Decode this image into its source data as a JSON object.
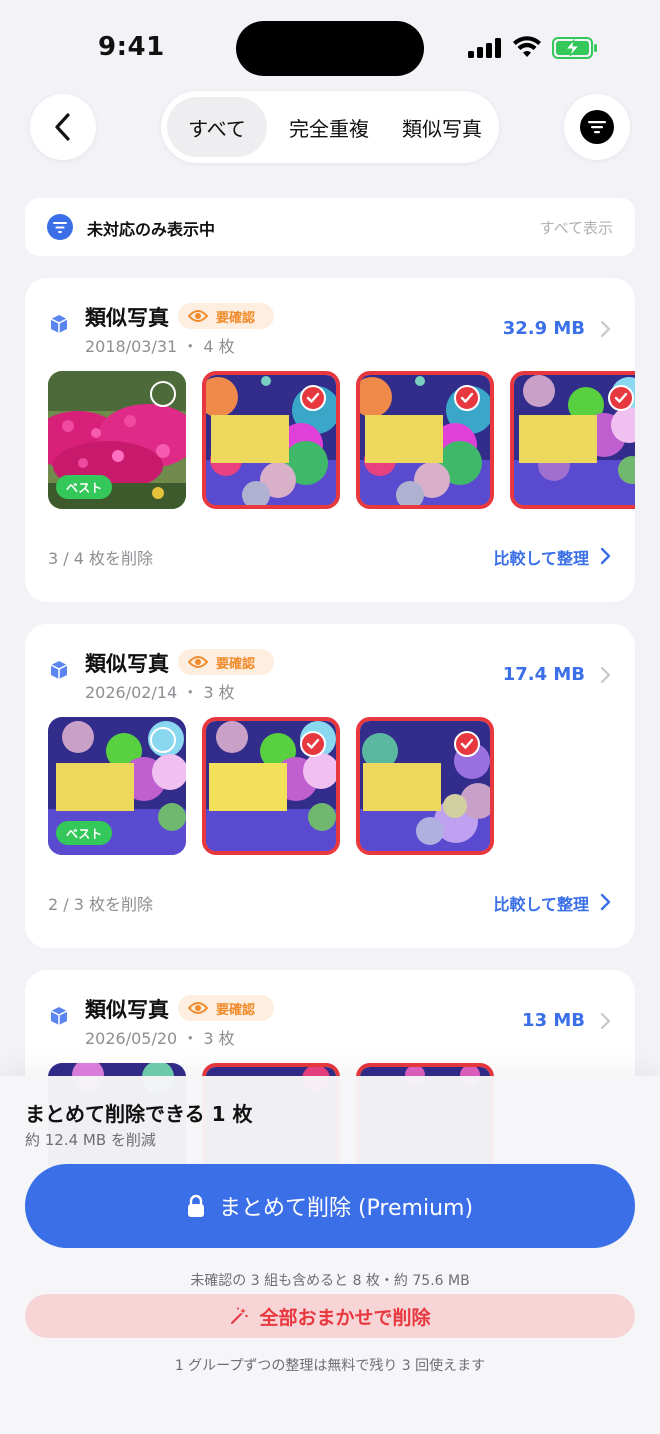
{
  "status": {
    "time": "9:41"
  },
  "nav": {
    "tabs": [
      {
        "label": "すべて",
        "active": true
      },
      {
        "label": "完全重複",
        "active": false
      },
      {
        "label": "類似写真",
        "active": false
      }
    ]
  },
  "banner": {
    "text": "未対応のみ表示中",
    "link": "すべて表示"
  },
  "groups": [
    {
      "title": "類似写真",
      "badge": "要確認",
      "date": "2018/03/31 ・ 4 枚",
      "size": "32.9 MB",
      "summary": "3 / 4 枚を削除",
      "action": "比較して整理",
      "best_label": "ベスト"
    },
    {
      "title": "類似写真",
      "badge": "要確認",
      "date": "2026/02/14 ・ 3 枚",
      "size": "17.4 MB",
      "summary": "2 / 3 枚を削除",
      "action": "比較して整理",
      "best_label": "ベスト"
    },
    {
      "title": "類似写真",
      "badge": "要確認",
      "date": "2026/05/20 ・ 3 枚",
      "size": "13 MB"
    }
  ],
  "sheet": {
    "title": "まとめて削除できる 1 枚",
    "subtitle": "約 12.4 MB を削減",
    "primary_button": "まとめて削除 (Premium)",
    "note": "未確認の 3 組も含めると 8 枚・約 75.6 MB",
    "secondary_button": "全部おまかせで削除",
    "footer": "1 グループずつの整理は無料で残り 3 回使えます"
  },
  "colors": {
    "accent": "#3b6fe8",
    "danger": "#e8383f",
    "warning": "#f08a2a",
    "best": "#34c759"
  }
}
